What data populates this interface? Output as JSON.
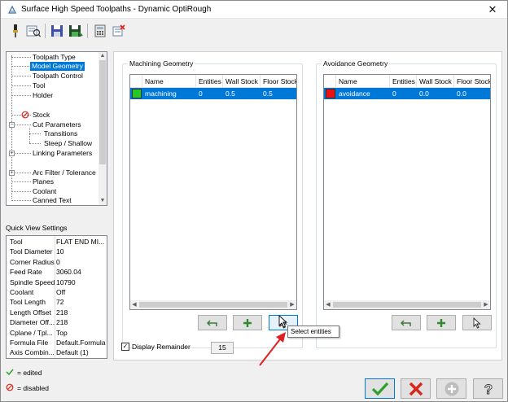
{
  "window": {
    "title": "Surface High Speed Toolpaths - Dynamic OptiRough",
    "close_glyph": "✕"
  },
  "toolbar": {
    "buttons": [
      "tool-library-icon",
      "view-sheet-icon",
      "save-icon",
      "save-as-icon",
      "calculator-icon",
      "clear-icon"
    ]
  },
  "tree": {
    "items": [
      "Toolpath Type",
      "Model Geometry",
      "Toolpath Control",
      "Tool",
      "Holder",
      "Stock",
      "Cut Parameters",
      "Transitions",
      "Steep / Shallow",
      "Linking Parameters",
      "Arc Filter / Tolerance",
      "Planes",
      "Coolant",
      "Canned Text"
    ],
    "selected": "Model Geometry"
  },
  "quick_view": {
    "label": "Quick View Settings",
    "rows": [
      {
        "k": "Tool",
        "v": "FLAT END MI..."
      },
      {
        "k": "Tool Diameter",
        "v": "10"
      },
      {
        "k": "Corner Radius",
        "v": "0"
      },
      {
        "k": "Feed Rate",
        "v": "3060.04"
      },
      {
        "k": "Spindle Speed",
        "v": "10790"
      },
      {
        "k": "Coolant",
        "v": "Off"
      },
      {
        "k": "Tool Length",
        "v": "72"
      },
      {
        "k": "Length Offset",
        "v": "218"
      },
      {
        "k": "Diameter Off...",
        "v": "218"
      },
      {
        "k": "Cplane / Tpl...",
        "v": "Top"
      },
      {
        "k": "Formula File",
        "v": "Default.Formula"
      },
      {
        "k": "Axis Combin...",
        "v": "Default (1)"
      }
    ]
  },
  "legend": {
    "edited": "= edited",
    "disabled": "= disabled"
  },
  "machining": {
    "title": "Machining Geometry",
    "columns": [
      "Name",
      "Entities",
      "Wall Stock",
      "Floor Stock"
    ],
    "row": {
      "name": "machining",
      "entities": "0",
      "wall": "0.5",
      "floor": "0.5",
      "color": "#22cc22"
    }
  },
  "avoidance": {
    "title": "Avoidance Geometry",
    "columns": [
      "Name",
      "Entities",
      "Wall Stock",
      "Floor Stock"
    ],
    "row": {
      "name": "avoidance",
      "entities": "0",
      "wall": "0.0",
      "floor": "0.0",
      "color": "#ee1111"
    }
  },
  "display_remainder": {
    "label": "Display Remainder",
    "checked": true,
    "value": "15"
  },
  "tooltip": "Select entities",
  "colors": {
    "selection": "#0078d7",
    "arrow": "#e0201f",
    "ok_green": "#2ea02e",
    "cancel_red": "#d9261c"
  }
}
